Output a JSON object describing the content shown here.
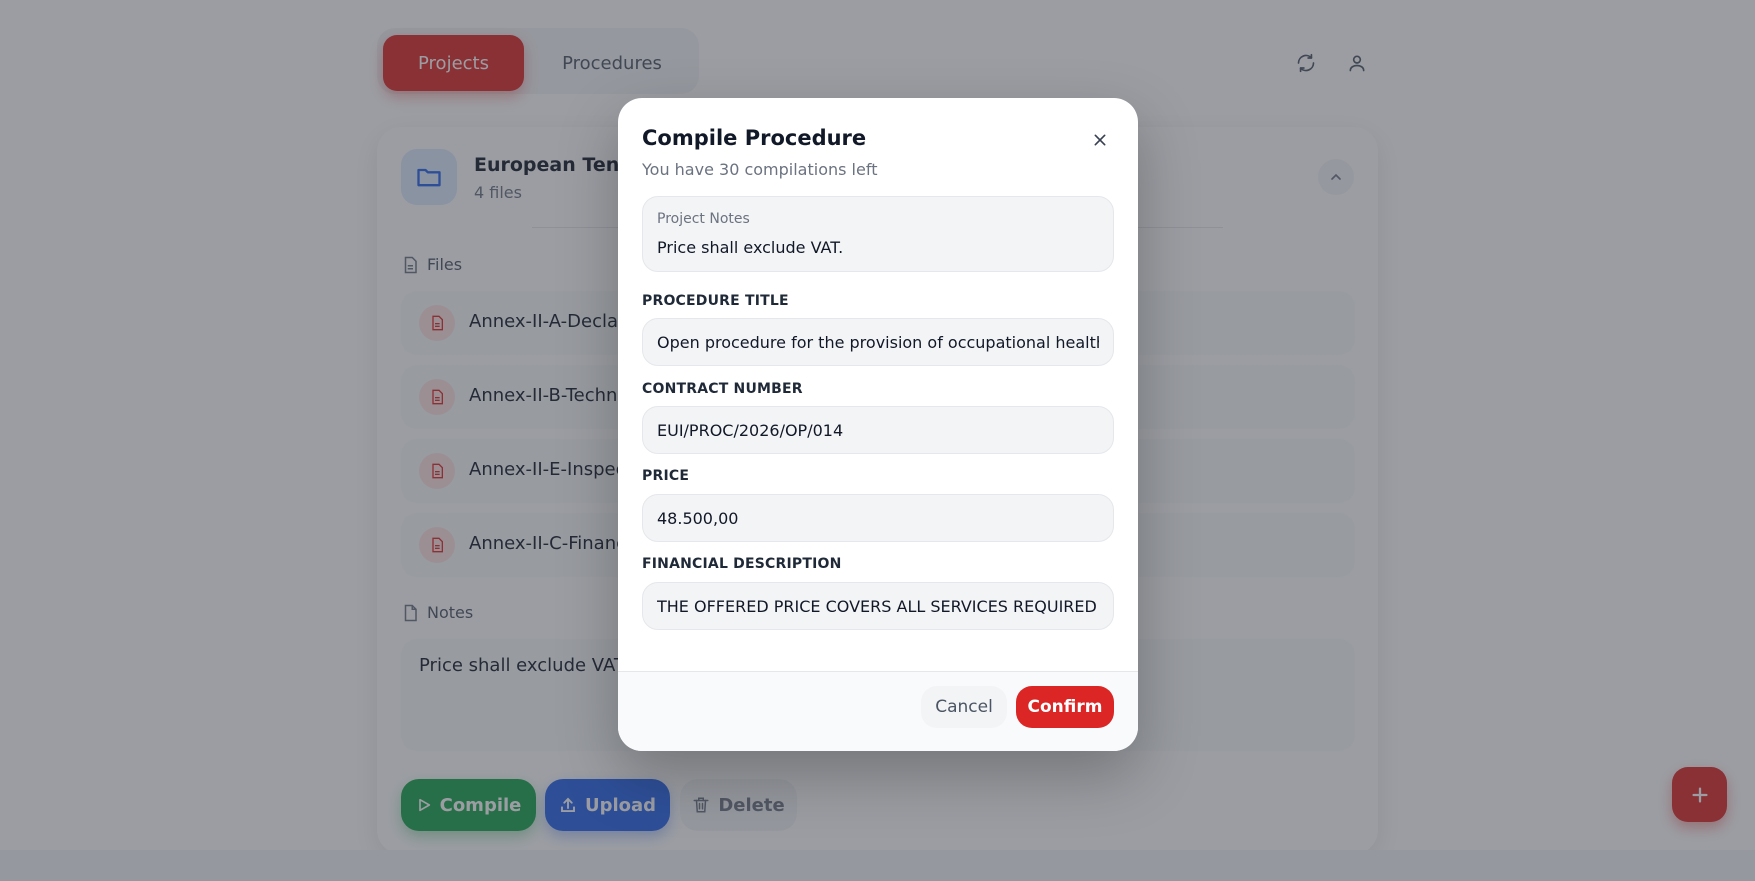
{
  "tabs": {
    "projects_label": "Projects",
    "procedures_label": "Procedures"
  },
  "header_icons": [
    "refresh-icon",
    "user-icon"
  ],
  "project": {
    "name": "European Tender",
    "file_count": "4 files",
    "files_heading": "Files",
    "files": [
      {
        "name": "Annex-II-A-Declar"
      },
      {
        "name": "Annex-II-B-Techni"
      },
      {
        "name": "Annex-II-E-Inspect"
      },
      {
        "name": "Annex-II-C-Financ"
      }
    ],
    "notes_heading": "Notes",
    "notes_text": "Price shall exclude VAT.",
    "actions": {
      "compile": "Compile",
      "upload": "Upload",
      "delete": "Delete"
    }
  },
  "colors": {
    "accent_red": "#dc2626",
    "compile_green": "#16a34a",
    "upload_blue": "#2563eb"
  },
  "modal": {
    "title": "Compile Procedure",
    "subtitle": "You have 30 compilations left",
    "notes_label": "Project Notes",
    "notes_value": "Price shall exclude VAT.",
    "fields": {
      "procedure_title_label": "PROCEDURE TITLE",
      "procedure_title_value": "Open procedure for the provision of occupational health and s",
      "contract_number_label": "CONTRACT NUMBER",
      "contract_number_value": "EUI/PROC/2026/OP/014",
      "price_label": "PRICE",
      "price_value": "48.500,00",
      "financial_description_label": "FINANCIAL DESCRIPTION",
      "financial_description_value": "THE OFFERED PRICE COVERS ALL SERVICES REQUIRED FOR TH"
    },
    "cancel_label": "Cancel",
    "confirm_label": "Confirm"
  }
}
